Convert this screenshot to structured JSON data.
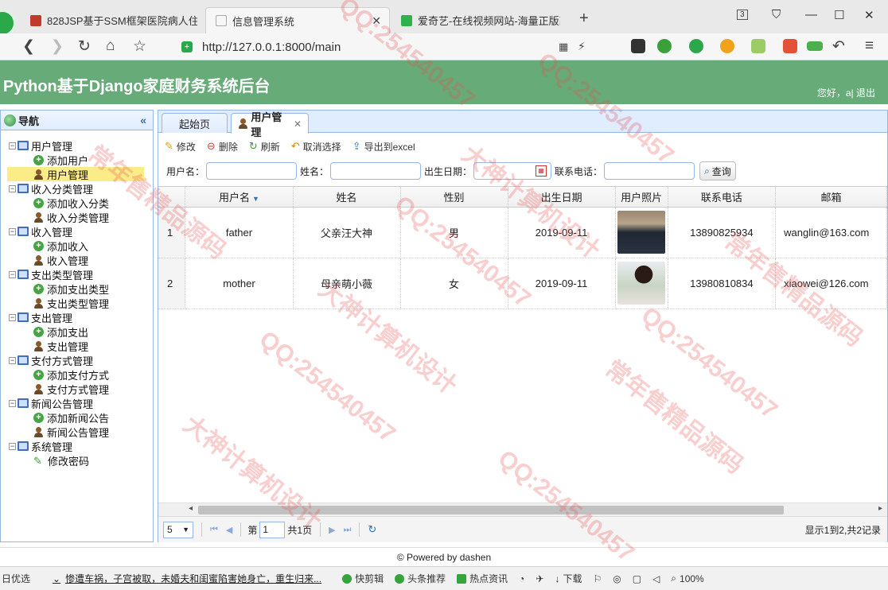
{
  "browser": {
    "tabs": [
      {
        "title": "828JSP基于SSM框架医院病人住",
        "active": false,
        "favicon_color": "#c0392b"
      },
      {
        "title": "信息管理系统",
        "active": true,
        "favicon_color": "#ffffff"
      },
      {
        "title": "爱奇艺-在线视频网站-海量正版高",
        "active": false,
        "favicon_color": "#2fb24c"
      }
    ],
    "tab_count": "3",
    "url": "http://127.0.0.1:8000/main"
  },
  "header": {
    "title": "Python基于Django家庭财务系统后台",
    "greeting": "您好，a|",
    "logout": "退出"
  },
  "sidebar": {
    "title": "导航",
    "groups": [
      {
        "label": "用户管理",
        "items": [
          {
            "label": "添加用户",
            "icon": "add-icon"
          },
          {
            "label": "用户管理",
            "icon": "user-icon",
            "selected": true
          }
        ]
      },
      {
        "label": "收入分类管理",
        "items": [
          {
            "label": "添加收入分类",
            "icon": "add-icon"
          },
          {
            "label": "收入分类管理",
            "icon": "user-icon"
          }
        ]
      },
      {
        "label": "收入管理",
        "items": [
          {
            "label": "添加收入",
            "icon": "add-icon"
          },
          {
            "label": "收入管理",
            "icon": "user-icon"
          }
        ]
      },
      {
        "label": "支出类型管理",
        "items": [
          {
            "label": "添加支出类型",
            "icon": "add-icon"
          },
          {
            "label": "支出类型管理",
            "icon": "user-icon"
          }
        ]
      },
      {
        "label": "支出管理",
        "items": [
          {
            "label": "添加支出",
            "icon": "add-icon"
          },
          {
            "label": "支出管理",
            "icon": "user-icon"
          }
        ]
      },
      {
        "label": "支付方式管理",
        "items": [
          {
            "label": "添加支付方式",
            "icon": "add-icon"
          },
          {
            "label": "支付方式管理",
            "icon": "user-icon"
          }
        ]
      },
      {
        "label": "新闻公告管理",
        "items": [
          {
            "label": "添加新闻公告",
            "icon": "add-icon"
          },
          {
            "label": "新闻公告管理",
            "icon": "user-icon"
          }
        ]
      },
      {
        "label": "系统管理",
        "items": [
          {
            "label": "修改密码",
            "icon": "pencil-icon"
          }
        ]
      }
    ]
  },
  "main": {
    "tabs": [
      {
        "label": "起始页"
      },
      {
        "label": "用户管理",
        "active": true
      }
    ],
    "toolbar": {
      "edit": "修改",
      "delete": "删除",
      "refresh": "刷新",
      "cancel_select": "取消选择",
      "export": "导出到excel"
    },
    "search": {
      "username_label": "用户名：",
      "username_value": "",
      "name_label": "姓名：",
      "name_value": "",
      "birth_label": "出生日期：",
      "birth_value": "",
      "phone_label": "联系电话：",
      "phone_value": "",
      "query_button": "查询"
    },
    "table": {
      "columns": [
        "用户名",
        "姓名",
        "性别",
        "出生日期",
        "用户照片",
        "联系电话",
        "邮箱"
      ],
      "rows": [
        {
          "num": "1",
          "username": "father",
          "name": "父亲汪大神",
          "gender": "男",
          "birth": "2019-09-11",
          "phone": "13890825934",
          "email": "wanglin@163.com"
        },
        {
          "num": "2",
          "username": "mother",
          "name": "母亲萌小薇",
          "gender": "女",
          "birth": "2019-09-11",
          "phone": "13980810834",
          "email": "xiaowei@126.com"
        }
      ]
    },
    "pager": {
      "page_size": "5",
      "page_prefix": "第",
      "page_value": "1",
      "page_suffix": "共1页",
      "info": "显示1到2,共2记录"
    }
  },
  "footer": {
    "text": "© Powered by dashen"
  },
  "statusbar": {
    "left": "日优选",
    "news": "惨遭车祸，子宫被取，未婚夫和闺蜜陷害她身亡，重生归来...",
    "quick_clip": "快剪辑",
    "headlines": "头条推荐",
    "hot": "热点资讯",
    "download": "下载",
    "zoom": "100%"
  },
  "watermarks": [
    "QQ:254540457",
    "大神计算机设计",
    "常年售精品源码"
  ]
}
